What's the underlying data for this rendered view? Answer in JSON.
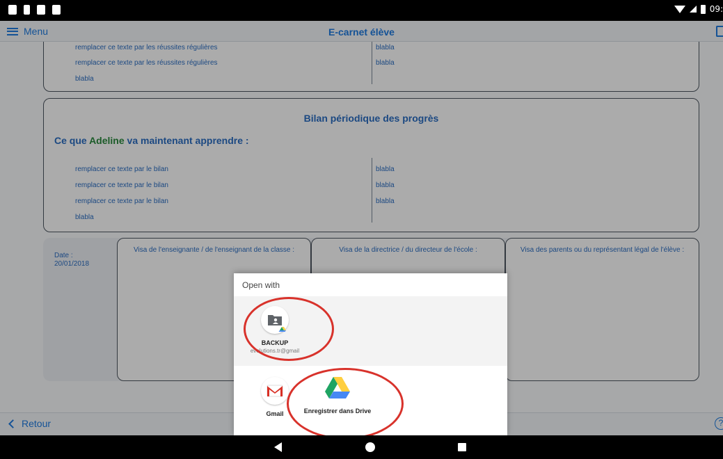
{
  "statusbar": {
    "time": "09:"
  },
  "appbar": {
    "menu_label": "Menu",
    "title": "E-carnet élève"
  },
  "section_top": {
    "rows_left": [
      "remplacer ce texte par les réussites régulières",
      "remplacer ce texte par les réussites régulières",
      "blabla"
    ],
    "rows_right": [
      "blabla",
      "blabla"
    ]
  },
  "section_bilan": {
    "title": "Bilan périodique des progrès",
    "heading_prefix": "Ce que",
    "student_name": "Adeline",
    "heading_suffix": "va maintenant apprendre :",
    "rows_left": [
      "remplacer ce texte par le bilan",
      "remplacer ce texte par le bilan",
      "remplacer ce texte par le bilan",
      "blabla"
    ],
    "rows_right": [
      "blabla",
      "blabla",
      "blabla"
    ]
  },
  "visa": {
    "date_label": "Date :",
    "date_value": "20/01/2018",
    "teacher": "Visa de l'enseignante / de l'enseignant de la classe :",
    "director": "Visa de la directrice / du directeur de l'école :",
    "parents": "Visa des parents ou du représentant légal de l'élève :"
  },
  "bottom_bar": {
    "back_label": "Retour",
    "help_icon_glyph": "?"
  },
  "sheet": {
    "title": "Open with",
    "apps": [
      {
        "name": "BACKUP",
        "account": "evolutions.tr@gmail",
        "icon": "drive-folder-icon"
      },
      {
        "name": "Gmail",
        "icon": "gmail-icon"
      },
      {
        "name": "Enregistrer dans Drive",
        "icon": "google-drive-icon"
      }
    ]
  },
  "colors": {
    "accent": "#1e7be0",
    "highlight_circle": "#d8322b",
    "student_name": "#2a8a3e"
  }
}
